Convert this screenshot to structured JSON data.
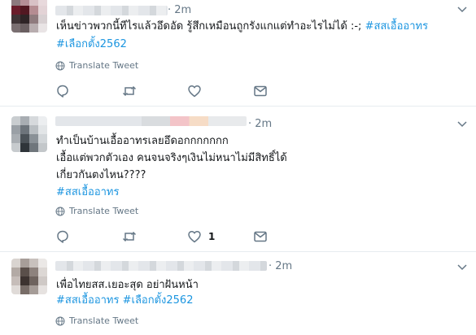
{
  "tweets": [
    {
      "time": "· 2m",
      "lines": [
        {
          "text": "เห็นข่าวพวกนี้ทีไรแล้วอึดอัด รู้สึกเหมือนถูกรังแกแต่ทำอะไรไม่ได้ :-; ",
          "tag": "#สสเอื้ออาทร"
        },
        {
          "text": "",
          "tag": "#เลือกตั้ง2562"
        }
      ],
      "translate_label": "Translate Tweet",
      "like_count": ""
    },
    {
      "time": "· 2m",
      "lines": [
        {
          "text": "ทำเป็นบ้านเอื้ออาทรเลยอึดอกกกกกกก",
          "tag": ""
        },
        {
          "text": "เอื้อแต่พวกตัวเอง คนจนจริงๆเงินไม่หนาไม่มีสิทธิ์ได้",
          "tag": ""
        },
        {
          "text": "เกี่ยวกันตงไหน????",
          "tag": ""
        },
        {
          "text": "",
          "tag": "#สสเอื้ออาทร"
        }
      ],
      "translate_label": "Translate Tweet",
      "like_count": "1"
    },
    {
      "time": "· 2m",
      "lines": [
        {
          "text": "เพื่อไทยสส.เยอะสุด อย่าฝันหน้า",
          "tag": ""
        },
        {
          "text": "",
          "tag": "#สสเอื้ออาทร #เลือกตั้ง2562"
        }
      ],
      "translate_label": "Translate Tweet",
      "like_count": ""
    }
  ],
  "colors": {
    "text": "#14171a",
    "secondary": "#657786",
    "hashtag": "#1b95e0",
    "divider": "#e6ecf0"
  },
  "icons": {
    "reply": "reply-icon",
    "retweet": "retweet-icon",
    "like": "heart-icon",
    "dm": "envelope-icon",
    "menu": "chevron-down-icon",
    "translate": "globe-icon"
  }
}
